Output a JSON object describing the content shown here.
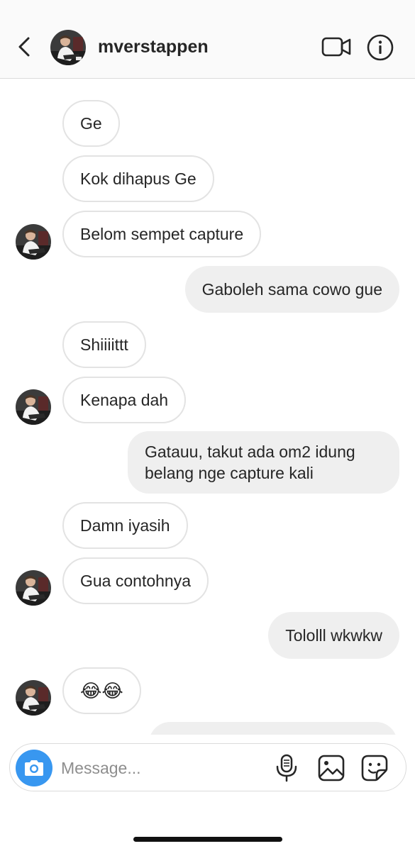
{
  "header": {
    "username": "mverstappen",
    "back_icon": "chevron-left-icon",
    "video_icon": "video-camera-icon",
    "info_icon": "info-icon"
  },
  "messages": [
    {
      "direction": "in",
      "text": "Ge"
    },
    {
      "direction": "in",
      "text": "Kok dihapus Ge"
    },
    {
      "direction": "in",
      "text": "Belom sempet capture"
    },
    {
      "direction": "out",
      "text": "Gaboleh sama cowo gue"
    },
    {
      "direction": "in",
      "text": "Shiiiittt"
    },
    {
      "direction": "in",
      "text": "Kenapa dah"
    },
    {
      "direction": "out",
      "text": "Gatauu, takut ada om2 idung belang nge capture kali"
    },
    {
      "direction": "in",
      "text": "Damn iyasih"
    },
    {
      "direction": "in",
      "text": "Gua contohnya"
    },
    {
      "direction": "out",
      "text": "Tololll wkwkw"
    },
    {
      "direction": "in",
      "text": "😂😂"
    },
    {
      "direction": "out",
      "text": ""
    }
  ],
  "composer": {
    "placeholder": "Message...",
    "camera_icon": "camera-icon",
    "mic_icon": "microphone-icon",
    "gallery_icon": "gallery-icon",
    "sticker_icon": "sticker-icon"
  },
  "colors": {
    "header_bg": "#fafafa",
    "incoming_border": "#e3e3e3",
    "outgoing_bg": "#efefef",
    "camera_accent": "#3897f0"
  }
}
